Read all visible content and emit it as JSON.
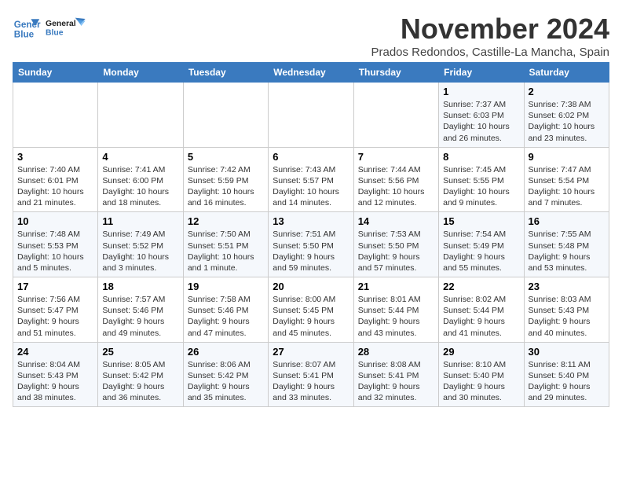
{
  "header": {
    "logo_line1": "General",
    "logo_line2": "Blue",
    "month": "November 2024",
    "location": "Prados Redondos, Castille-La Mancha, Spain"
  },
  "weekdays": [
    "Sunday",
    "Monday",
    "Tuesday",
    "Wednesday",
    "Thursday",
    "Friday",
    "Saturday"
  ],
  "weeks": [
    [
      {
        "day": "",
        "info": ""
      },
      {
        "day": "",
        "info": ""
      },
      {
        "day": "",
        "info": ""
      },
      {
        "day": "",
        "info": ""
      },
      {
        "day": "",
        "info": ""
      },
      {
        "day": "1",
        "info": "Sunrise: 7:37 AM\nSunset: 6:03 PM\nDaylight: 10 hours and 26 minutes."
      },
      {
        "day": "2",
        "info": "Sunrise: 7:38 AM\nSunset: 6:02 PM\nDaylight: 10 hours and 23 minutes."
      }
    ],
    [
      {
        "day": "3",
        "info": "Sunrise: 7:40 AM\nSunset: 6:01 PM\nDaylight: 10 hours and 21 minutes."
      },
      {
        "day": "4",
        "info": "Sunrise: 7:41 AM\nSunset: 6:00 PM\nDaylight: 10 hours and 18 minutes."
      },
      {
        "day": "5",
        "info": "Sunrise: 7:42 AM\nSunset: 5:59 PM\nDaylight: 10 hours and 16 minutes."
      },
      {
        "day": "6",
        "info": "Sunrise: 7:43 AM\nSunset: 5:57 PM\nDaylight: 10 hours and 14 minutes."
      },
      {
        "day": "7",
        "info": "Sunrise: 7:44 AM\nSunset: 5:56 PM\nDaylight: 10 hours and 12 minutes."
      },
      {
        "day": "8",
        "info": "Sunrise: 7:45 AM\nSunset: 5:55 PM\nDaylight: 10 hours and 9 minutes."
      },
      {
        "day": "9",
        "info": "Sunrise: 7:47 AM\nSunset: 5:54 PM\nDaylight: 10 hours and 7 minutes."
      }
    ],
    [
      {
        "day": "10",
        "info": "Sunrise: 7:48 AM\nSunset: 5:53 PM\nDaylight: 10 hours and 5 minutes."
      },
      {
        "day": "11",
        "info": "Sunrise: 7:49 AM\nSunset: 5:52 PM\nDaylight: 10 hours and 3 minutes."
      },
      {
        "day": "12",
        "info": "Sunrise: 7:50 AM\nSunset: 5:51 PM\nDaylight: 10 hours and 1 minute."
      },
      {
        "day": "13",
        "info": "Sunrise: 7:51 AM\nSunset: 5:50 PM\nDaylight: 9 hours and 59 minutes."
      },
      {
        "day": "14",
        "info": "Sunrise: 7:53 AM\nSunset: 5:50 PM\nDaylight: 9 hours and 57 minutes."
      },
      {
        "day": "15",
        "info": "Sunrise: 7:54 AM\nSunset: 5:49 PM\nDaylight: 9 hours and 55 minutes."
      },
      {
        "day": "16",
        "info": "Sunrise: 7:55 AM\nSunset: 5:48 PM\nDaylight: 9 hours and 53 minutes."
      }
    ],
    [
      {
        "day": "17",
        "info": "Sunrise: 7:56 AM\nSunset: 5:47 PM\nDaylight: 9 hours and 51 minutes."
      },
      {
        "day": "18",
        "info": "Sunrise: 7:57 AM\nSunset: 5:46 PM\nDaylight: 9 hours and 49 minutes."
      },
      {
        "day": "19",
        "info": "Sunrise: 7:58 AM\nSunset: 5:46 PM\nDaylight: 9 hours and 47 minutes."
      },
      {
        "day": "20",
        "info": "Sunrise: 8:00 AM\nSunset: 5:45 PM\nDaylight: 9 hours and 45 minutes."
      },
      {
        "day": "21",
        "info": "Sunrise: 8:01 AM\nSunset: 5:44 PM\nDaylight: 9 hours and 43 minutes."
      },
      {
        "day": "22",
        "info": "Sunrise: 8:02 AM\nSunset: 5:44 PM\nDaylight: 9 hours and 41 minutes."
      },
      {
        "day": "23",
        "info": "Sunrise: 8:03 AM\nSunset: 5:43 PM\nDaylight: 9 hours and 40 minutes."
      }
    ],
    [
      {
        "day": "24",
        "info": "Sunrise: 8:04 AM\nSunset: 5:43 PM\nDaylight: 9 hours and 38 minutes."
      },
      {
        "day": "25",
        "info": "Sunrise: 8:05 AM\nSunset: 5:42 PM\nDaylight: 9 hours and 36 minutes."
      },
      {
        "day": "26",
        "info": "Sunrise: 8:06 AM\nSunset: 5:42 PM\nDaylight: 9 hours and 35 minutes."
      },
      {
        "day": "27",
        "info": "Sunrise: 8:07 AM\nSunset: 5:41 PM\nDaylight: 9 hours and 33 minutes."
      },
      {
        "day": "28",
        "info": "Sunrise: 8:08 AM\nSunset: 5:41 PM\nDaylight: 9 hours and 32 minutes."
      },
      {
        "day": "29",
        "info": "Sunrise: 8:10 AM\nSunset: 5:40 PM\nDaylight: 9 hours and 30 minutes."
      },
      {
        "day": "30",
        "info": "Sunrise: 8:11 AM\nSunset: 5:40 PM\nDaylight: 9 hours and 29 minutes."
      }
    ]
  ]
}
